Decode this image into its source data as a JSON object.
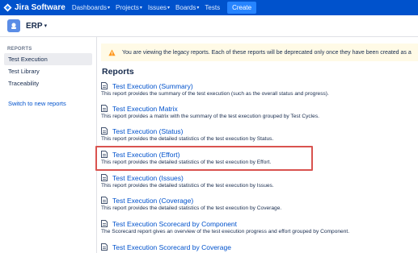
{
  "topbar": {
    "logo_text": "Jira Software",
    "nav": [
      {
        "label": "Dashboards"
      },
      {
        "label": "Projects"
      },
      {
        "label": "Issues"
      },
      {
        "label": "Boards"
      },
      {
        "label": "Tests"
      }
    ],
    "create_label": "Create",
    "color": "#0052cc"
  },
  "project": {
    "name": "ERP"
  },
  "sidebar": {
    "heading": "REPORTS",
    "items": [
      {
        "label": "Test Execution",
        "active": true
      },
      {
        "label": "Test Library",
        "active": false
      },
      {
        "label": "Traceability",
        "active": false
      }
    ],
    "switch_link": "Switch to new reports"
  },
  "banner": {
    "icon": "warning-icon",
    "text": "You are viewing the legacy reports. Each of these reports will be deprecated only once they have been created as a"
  },
  "main": {
    "title": "Reports",
    "reports": [
      {
        "title": "Test Execution (Summary)",
        "desc": "This report provides the summary of the test execution (such as the overall status and progress)."
      },
      {
        "title": "Test Execution Matrix",
        "desc": "This report provides a matrix with the summary of the test execution grouped by Test Cycles."
      },
      {
        "title": "Test Execution (Status)",
        "desc": "This report provides the detailed statistics of the test execution by Status."
      },
      {
        "title": "Test Execution (Effort)",
        "desc": "This report provides the detailed statistics of the test execution by Effort.",
        "highlighted": true
      },
      {
        "title": "Test Execution (Issues)",
        "desc": "This report provides the detailed statistics of the test execution by Issues."
      },
      {
        "title": "Test Execution (Coverage)",
        "desc": "This report provides the detailed statistics of the test execution by Coverage."
      },
      {
        "title": "Test Execution Scorecard by Component",
        "desc": "The Scorecard report gives an overview of the test execution progress and effort grouped by Component."
      },
      {
        "title": "Test Execution Scorecard by Coverage",
        "desc": ""
      }
    ]
  },
  "colors": {
    "link": "#0052cc",
    "highlight_border": "#d9534f",
    "banner_bg": "#fffae6"
  }
}
